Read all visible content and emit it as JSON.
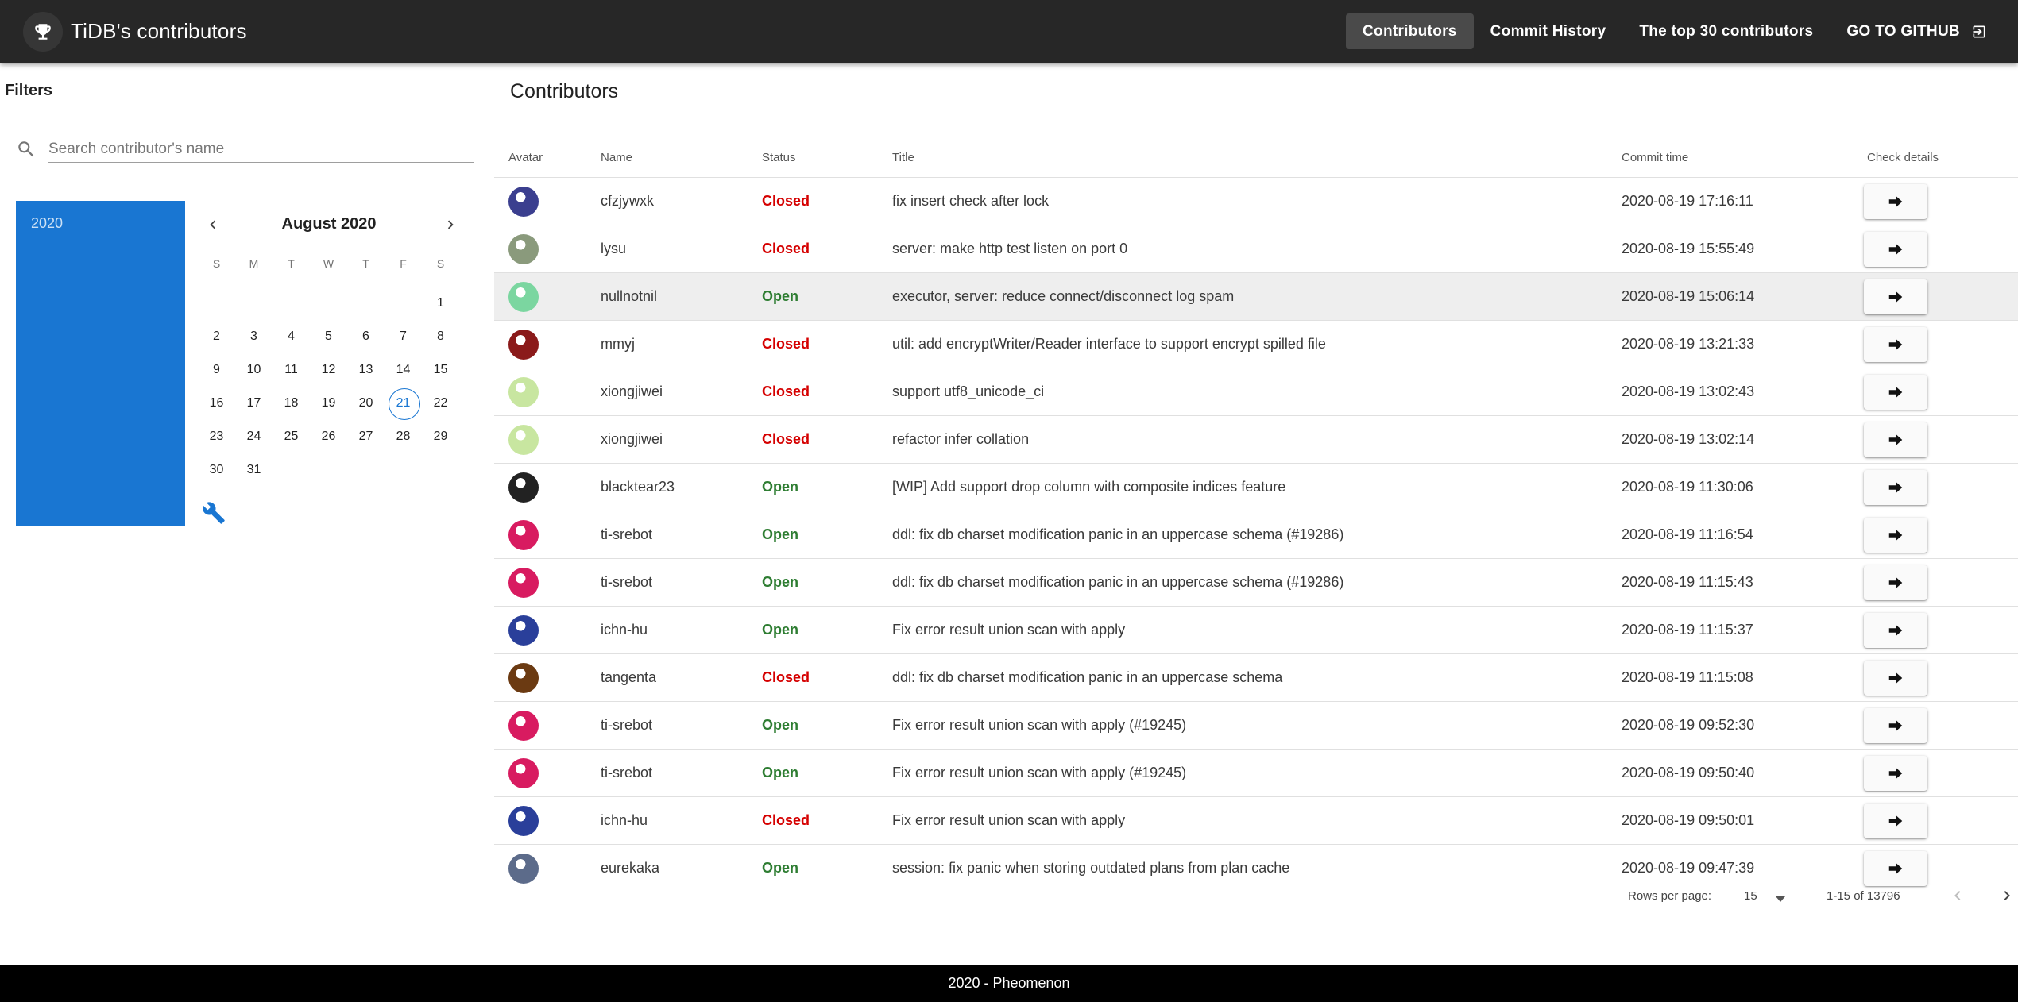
{
  "app": {
    "title": "TiDB's contributors"
  },
  "nav": {
    "items": [
      {
        "label": "Contributors",
        "active": true
      },
      {
        "label": "Commit History",
        "active": false
      },
      {
        "label": "The top 30 contributors",
        "active": false
      },
      {
        "label": "GO TO GITHUB",
        "active": false
      }
    ]
  },
  "sidebar": {
    "filters_title": "Filters",
    "search": {
      "placeholder": "Search contributor's name",
      "value": ""
    },
    "year": "2020",
    "calendar": {
      "month": "August 2020",
      "weekdays": [
        "S",
        "M",
        "T",
        "W",
        "T",
        "F",
        "S"
      ],
      "weeks": [
        [
          "",
          "",
          "",
          "",
          "",
          "",
          "1"
        ],
        [
          "2",
          "3",
          "4",
          "5",
          "6",
          "7",
          "8"
        ],
        [
          "9",
          "10",
          "11",
          "12",
          "13",
          "14",
          "15"
        ],
        [
          "16",
          "17",
          "18",
          "19",
          "20",
          "21",
          "22"
        ],
        [
          "23",
          "24",
          "25",
          "26",
          "27",
          "28",
          "29"
        ],
        [
          "30",
          "31",
          "",
          "",
          "",
          "",
          ""
        ]
      ],
      "today": "21"
    }
  },
  "main": {
    "title": "Contributors",
    "columns": {
      "avatar": "Avatar",
      "name": "Name",
      "status": "Status",
      "title": "Title",
      "time": "Commit time",
      "check": "Check details"
    },
    "rows": [
      {
        "name": "cfzjywxk",
        "status": "Closed",
        "title": "fix insert check after lock",
        "time": "2020-08-19 17:16:11",
        "avatar_color": "#3b3f8f"
      },
      {
        "name": "lysu",
        "status": "Closed",
        "title": "server: make http test listen on port 0",
        "time": "2020-08-19 15:55:49",
        "avatar_color": "#8a9a7c"
      },
      {
        "name": "nullnotnil",
        "status": "Open",
        "title": "executor, server: reduce connect/disconnect log spam",
        "time": "2020-08-19 15:06:14",
        "avatar_color": "#7bd6a0"
      },
      {
        "name": "mmyj",
        "status": "Closed",
        "title": "util: add encryptWriter/Reader interface to support encrypt spilled file",
        "time": "2020-08-19 13:21:33",
        "avatar_color": "#8b1a1a"
      },
      {
        "name": "xiongjiwei",
        "status": "Closed",
        "title": "support utf8_unicode_ci",
        "time": "2020-08-19 13:02:43",
        "avatar_color": "#c8e6a0"
      },
      {
        "name": "xiongjiwei",
        "status": "Closed",
        "title": "refactor infer collation",
        "time": "2020-08-19 13:02:14",
        "avatar_color": "#c8e6a0"
      },
      {
        "name": "blacktear23",
        "status": "Open",
        "title": "[WIP] Add support drop column with composite indices feature",
        "time": "2020-08-19 11:30:06",
        "avatar_color": "#222222"
      },
      {
        "name": "ti-srebot",
        "status": "Open",
        "title": "ddl: fix db charset modification panic in an uppercase schema (#19286)",
        "time": "2020-08-19 11:16:54",
        "avatar_color": "#d81b60"
      },
      {
        "name": "ti-srebot",
        "status": "Open",
        "title": "ddl: fix db charset modification panic in an uppercase schema (#19286)",
        "time": "2020-08-19 11:15:43",
        "avatar_color": "#d81b60"
      },
      {
        "name": "ichn-hu",
        "status": "Open",
        "title": "Fix error result union scan with apply",
        "time": "2020-08-19 11:15:37",
        "avatar_color": "#2a3f9a"
      },
      {
        "name": "tangenta",
        "status": "Closed",
        "title": "ddl: fix db charset modification panic in an uppercase schema",
        "time": "2020-08-19 11:15:08",
        "avatar_color": "#6b3a12"
      },
      {
        "name": "ti-srebot",
        "status": "Open",
        "title": "Fix error result union scan with apply (#19245)",
        "time": "2020-08-19 09:52:30",
        "avatar_color": "#d81b60"
      },
      {
        "name": "ti-srebot",
        "status": "Open",
        "title": "Fix error result union scan with apply (#19245)",
        "time": "2020-08-19 09:50:40",
        "avatar_color": "#d81b60"
      },
      {
        "name": "ichn-hu",
        "status": "Closed",
        "title": "Fix error result union scan with apply",
        "time": "2020-08-19 09:50:01",
        "avatar_color": "#2a3f9a"
      },
      {
        "name": "eurekaka",
        "status": "Open",
        "title": "session: fix panic when storing outdated plans from plan cache",
        "time": "2020-08-19 09:47:39",
        "avatar_color": "#5c6b8a"
      }
    ],
    "highlighted_row": 2,
    "pagination": {
      "rows_per_page_label": "Rows per page:",
      "rows_per_page": "15",
      "range": "1-15 of 13796"
    }
  },
  "footer": {
    "text": "2020 - Pheomenon"
  },
  "colors": {
    "appbar": "#272727",
    "accent": "#1976d2",
    "closed": "#d50000",
    "open": "#2e7d32"
  }
}
